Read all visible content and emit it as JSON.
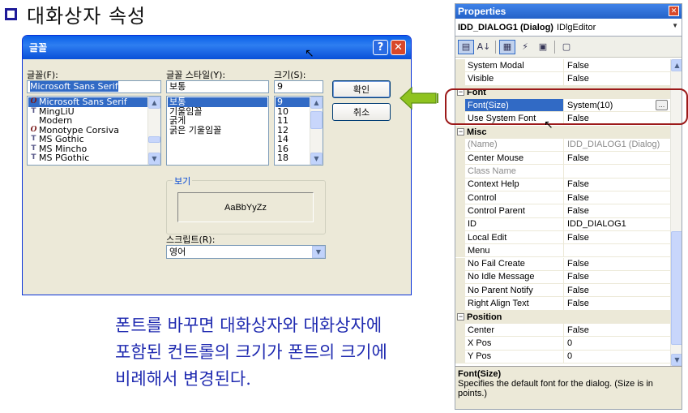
{
  "slide": {
    "heading": "대화상자 속성",
    "caption_lines": [
      "폰트를 바꾸면 대화상자와 대화상자에",
      "포함된 컨트롤의 크기가 폰트의 크기에",
      "비례해서 변경된다."
    ]
  },
  "font_dialog": {
    "title": "글꼴",
    "help_glyph": "?",
    "close_glyph": "✕",
    "font_label": "글꼴(F):",
    "font_value": "Microsoft Sans Serif",
    "fonts": [
      {
        "icon": "O",
        "name": "Microsoft Sans Serif",
        "selected": true
      },
      {
        "icon": "T",
        "name": "MingLiU",
        "selected": false
      },
      {
        "icon": "",
        "name": "Modern",
        "selected": false
      },
      {
        "icon": "O",
        "name": "Monotype Corsiva",
        "selected": false
      },
      {
        "icon": "T",
        "name": "MS Gothic",
        "selected": false
      },
      {
        "icon": "T",
        "name": "MS Mincho",
        "selected": false
      },
      {
        "icon": "T",
        "name": "MS PGothic",
        "selected": false
      }
    ],
    "style_label": "글꼴 스타일(Y):",
    "style_value": "보통",
    "styles": [
      {
        "name": "보통",
        "selected": true
      },
      {
        "name": "기울임꼴",
        "selected": false
      },
      {
        "name": "굵게",
        "selected": false
      },
      {
        "name": "굵은 기울임꼴",
        "selected": false
      }
    ],
    "size_label": "크기(S):",
    "size_value": "9",
    "sizes": [
      {
        "name": "9",
        "selected": true
      },
      {
        "name": "10",
        "selected": false
      },
      {
        "name": "11",
        "selected": false
      },
      {
        "name": "12",
        "selected": false
      },
      {
        "name": "14",
        "selected": false
      },
      {
        "name": "16",
        "selected": false
      },
      {
        "name": "18",
        "selected": false
      }
    ],
    "ok_label": "확인",
    "cancel_label": "취소",
    "preview_label": "보기",
    "preview_text": "AaBbYyZz",
    "script_label": "스크립트(R):",
    "script_value": "영어"
  },
  "properties": {
    "title": "Properties",
    "close_glyph": "✕",
    "object_name": "IDD_DIALOG1 (Dialog)",
    "object_type": "IDlgEditor",
    "rows": [
      {
        "kind": "prop",
        "name": "System Modal",
        "value": "False",
        "dim": false,
        "selected": false
      },
      {
        "kind": "prop",
        "name": "Visible",
        "value": "False",
        "dim": false,
        "selected": false
      },
      {
        "kind": "cat",
        "name": "Font",
        "value": "",
        "dim": false,
        "selected": false
      },
      {
        "kind": "prop",
        "name": "Font(Size)",
        "value": "System(10)",
        "dim": false,
        "selected": true
      },
      {
        "kind": "prop",
        "name": "Use System Font",
        "value": "False",
        "dim": false,
        "selected": false
      },
      {
        "kind": "cat",
        "name": "Misc",
        "value": "",
        "dim": false,
        "selected": false
      },
      {
        "kind": "prop",
        "name": "(Name)",
        "value": "IDD_DIALOG1 (Dialog)",
        "dim": true,
        "selected": false
      },
      {
        "kind": "prop",
        "name": "Center Mouse",
        "value": "False",
        "dim": false,
        "selected": false
      },
      {
        "kind": "prop",
        "name": "Class Name",
        "value": "",
        "dim": true,
        "selected": false
      },
      {
        "kind": "prop",
        "name": "Context Help",
        "value": "False",
        "dim": false,
        "selected": false
      },
      {
        "kind": "prop",
        "name": "Control",
        "value": "False",
        "dim": false,
        "selected": false
      },
      {
        "kind": "prop",
        "name": "Control Parent",
        "value": "False",
        "dim": false,
        "selected": false
      },
      {
        "kind": "prop",
        "name": "ID",
        "value": "IDD_DIALOG1",
        "dim": false,
        "selected": false
      },
      {
        "kind": "prop",
        "name": "Local Edit",
        "value": "False",
        "dim": false,
        "selected": false
      },
      {
        "kind": "prop",
        "name": "Menu",
        "value": "",
        "dim": false,
        "selected": false
      },
      {
        "kind": "prop",
        "name": "No Fail Create",
        "value": "False",
        "dim": false,
        "selected": false
      },
      {
        "kind": "prop",
        "name": "No Idle Message",
        "value": "False",
        "dim": false,
        "selected": false
      },
      {
        "kind": "prop",
        "name": "No Parent Notify",
        "value": "False",
        "dim": false,
        "selected": false
      },
      {
        "kind": "prop",
        "name": "Right Align Text",
        "value": "False",
        "dim": false,
        "selected": false
      },
      {
        "kind": "cat",
        "name": "Position",
        "value": "",
        "dim": false,
        "selected": false
      },
      {
        "kind": "prop",
        "name": "Center",
        "value": "False",
        "dim": false,
        "selected": false
      },
      {
        "kind": "prop",
        "name": "X Pos",
        "value": "0",
        "dim": false,
        "selected": false
      },
      {
        "kind": "prop",
        "name": "Y Pos",
        "value": "0",
        "dim": false,
        "selected": false
      }
    ],
    "description_title": "Font(Size)",
    "description_text": "Specifies the default font for the dialog. (Size is in points.)"
  },
  "colors": {
    "caption": "#1f2ab0",
    "highlight_ring": "#9c1a1a",
    "arrow_fill": "#8fc31f",
    "selection": "#316ac5"
  }
}
